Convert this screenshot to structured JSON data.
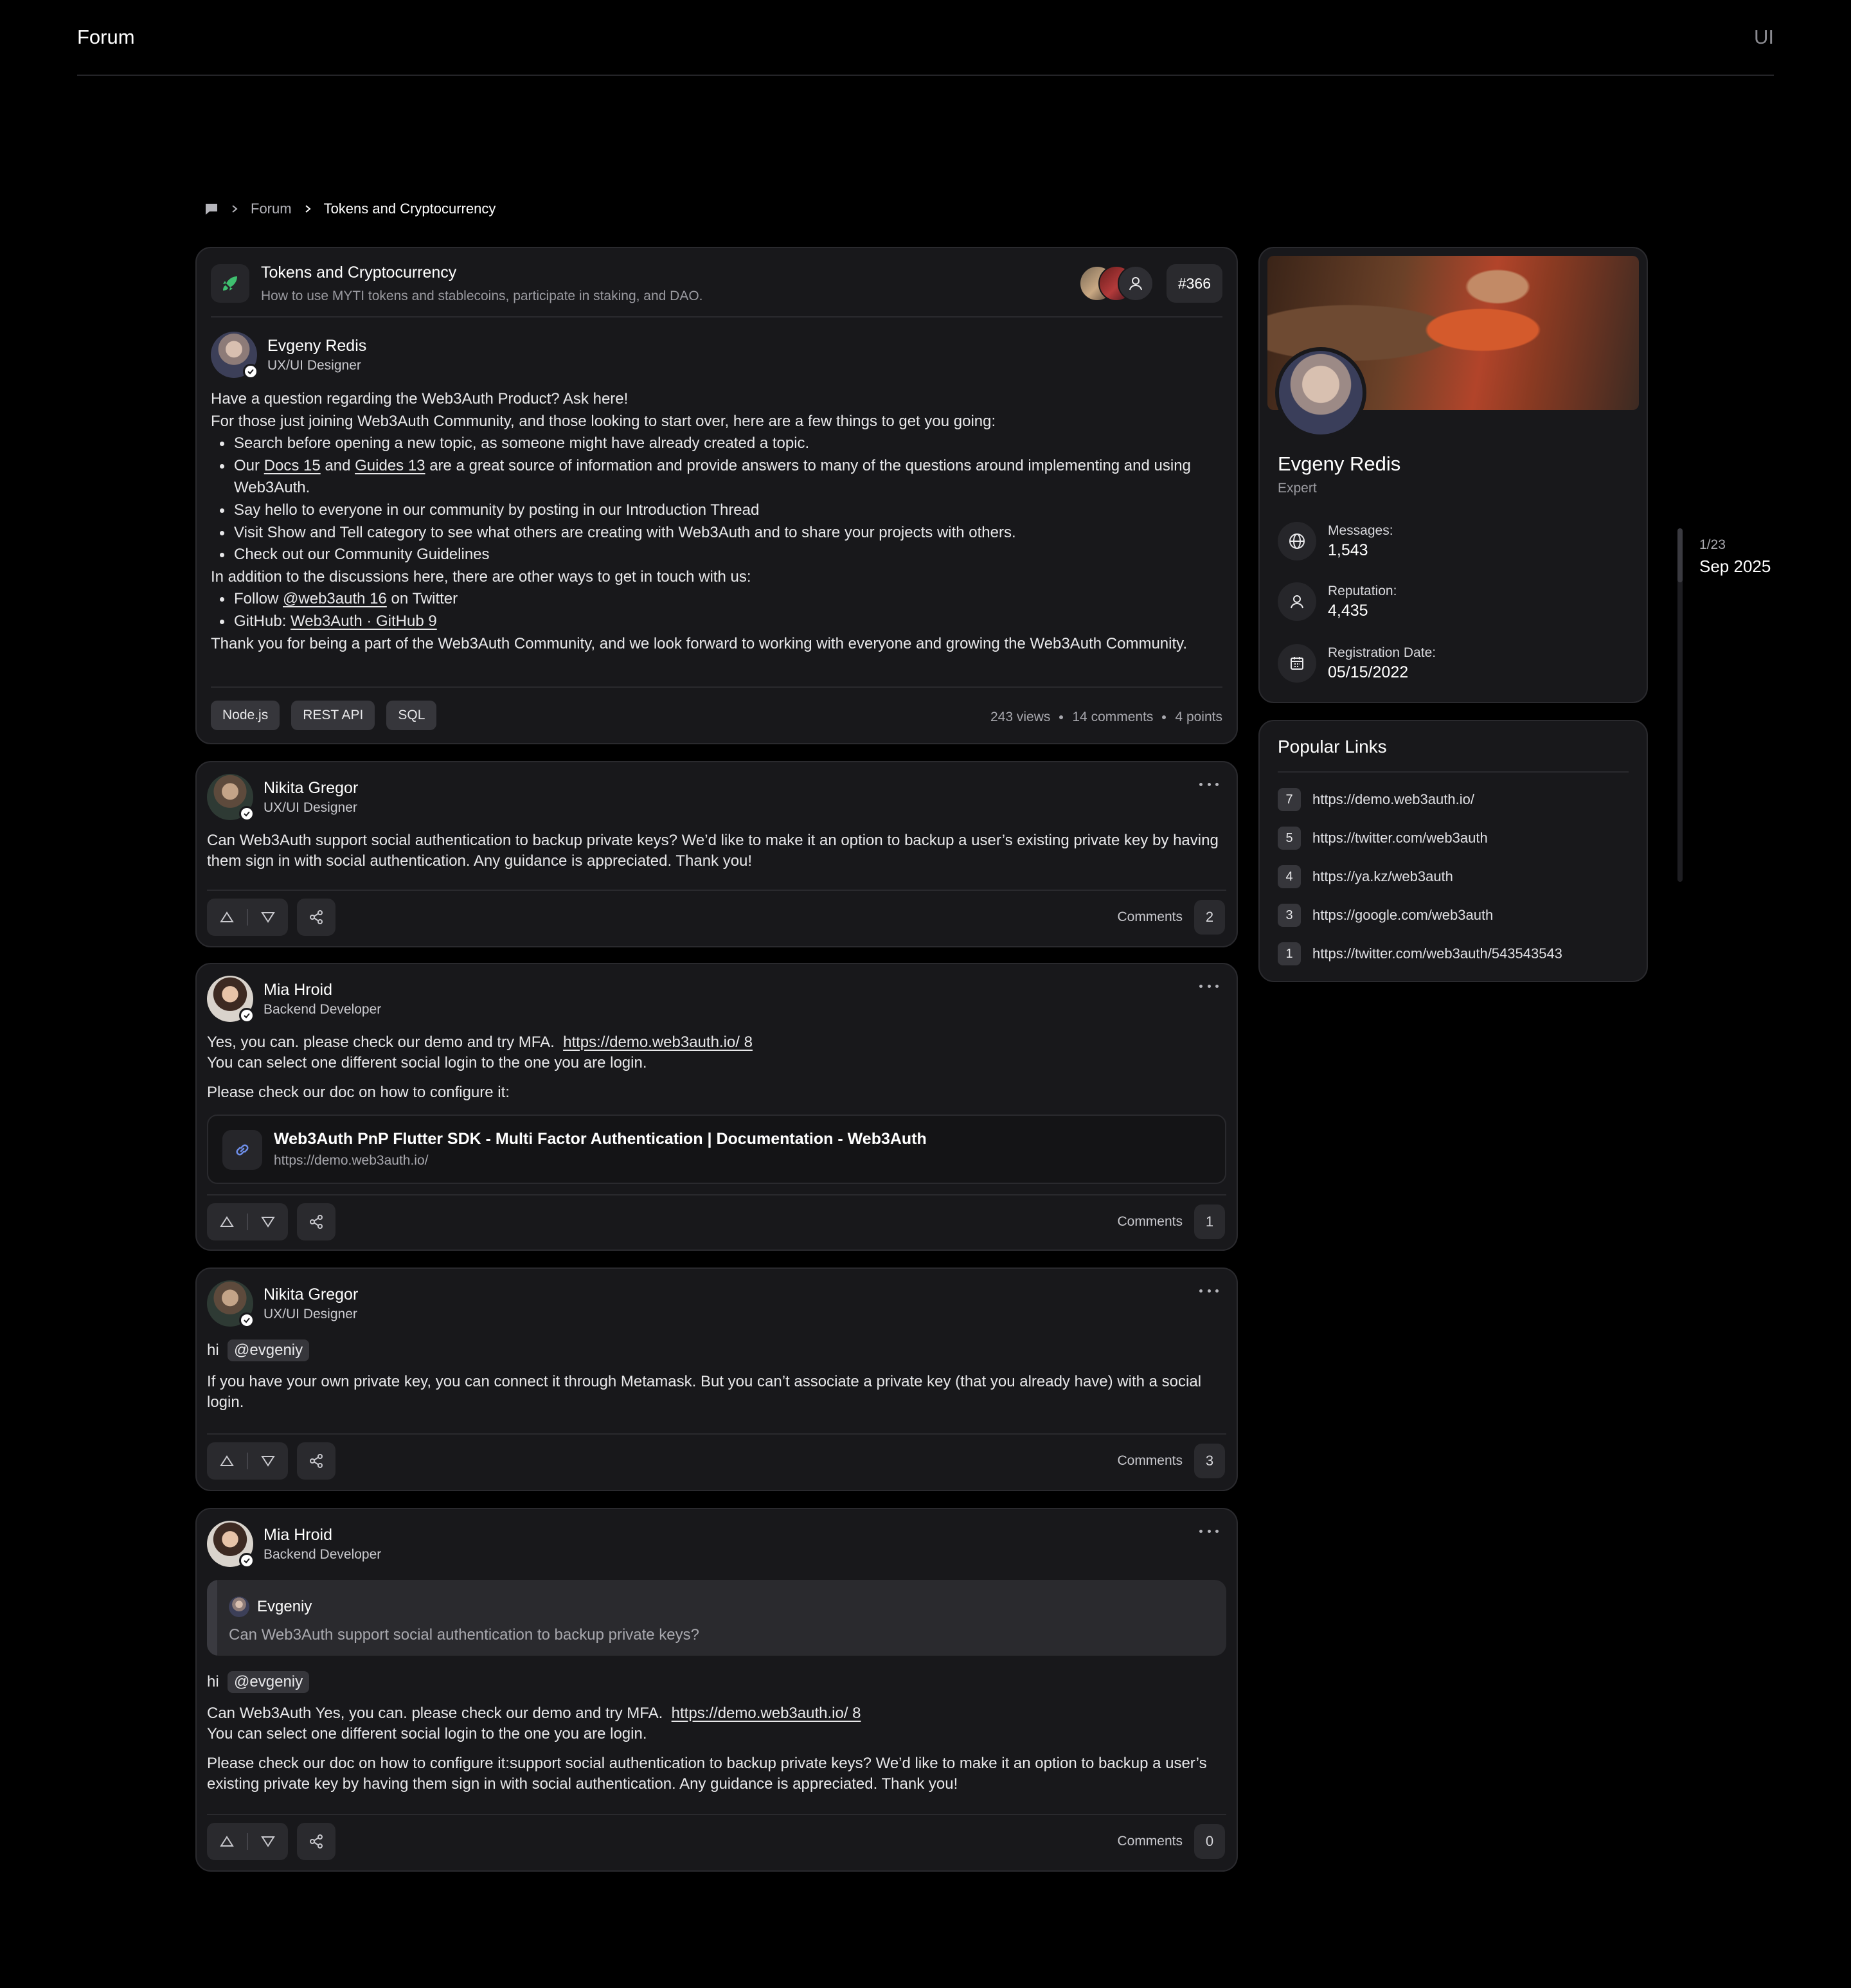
{
  "app": {
    "title": "Forum",
    "right_label": "UI"
  },
  "breadcrumb": {
    "items": [
      "Forum",
      "Tokens and Cryptocurrency"
    ]
  },
  "topic": {
    "title": "Tokens and Cryptocurrency",
    "subtitle": "How to use MYTI tokens and stablecoins, participate in staking, and DAO.",
    "badge": "#366",
    "author": {
      "name": "Evgeny Redis",
      "role": "UX/UI Designer"
    },
    "body": {
      "p1": "Have a question regarding the Web3Auth Product? Ask here!",
      "p2": "For those just joining Web3Auth Community, and those looking to start over, here are a few things to get you going:",
      "b1": "Search before opening a new topic, as someone might have already created a topic.",
      "b2_pre": "Our ",
      "b2_docs": "Docs 15",
      "b2_and": " and ",
      "b2_guides": "Guides 13",
      "b2_post": " are a great source of information and provide answers to many of the questions around implementing and using Web3Auth.",
      "b3": "Say hello to everyone in our community by posting in our Introduction Thread",
      "b4": "Visit Show and Tell category to see what others are creating with Web3Auth and to share your projects with others.",
      "b5": "Check out our Community Guidelines",
      "p3": "In addition to the discussions here, there are other ways to get in touch with us:",
      "b6_pre": "Follow ",
      "b6_link": "@web3auth 16",
      "b6_post": " on Twitter",
      "b7_pre": "GitHub: ",
      "b7_link": "Web3Auth · GitHub 9",
      "p4": "Thank you for being a part of the Web3Auth Community, and we look forward to working with everyone and growing the Web3Auth Community."
    },
    "tags": [
      "Node.js",
      "REST API",
      "SQL"
    ],
    "stats": {
      "views": "243 views",
      "comments": "14 comments",
      "points": "4 points"
    }
  },
  "posts": [
    {
      "author": {
        "name": "Nikita Gregor",
        "role": "UX/UI Designer"
      },
      "text": "Can Web3Auth support social authentication to backup private keys? We’d like to make it an option to backup a user’s existing private key by having them sign in with social authentication. Any guidance is appreciated. Thank you!",
      "comments_label": "Comments",
      "comments_count": "2"
    },
    {
      "author": {
        "name": "Mia Hroid",
        "role": "Backend Developer"
      },
      "line1": "Yes, you can. please check our demo and try MFA.",
      "line1_link": "https://demo.web3auth.io/ 8",
      "line2": "You can select one different social login to the one you are login.",
      "line3": "Please check our doc on how to configure it:",
      "link_title": "Web3Auth PnP Flutter SDK - Multi Factor Authentication | Documentation - Web3Auth",
      "link_url": "https://demo.web3auth.io/",
      "comments_label": "Comments",
      "comments_count": "1"
    },
    {
      "author": {
        "name": "Nikita Gregor",
        "role": "UX/UI Designer"
      },
      "hi": "hi",
      "mention": "@evgeniy",
      "text": "If you have your own private key, you can connect it through Metamask. But you can’t associate a private key (that you already have) with a social login.",
      "comments_label": "Comments",
      "comments_count": "3"
    },
    {
      "author": {
        "name": "Mia Hroid",
        "role": "Backend Developer"
      },
      "quote_author": "Evgeniy",
      "quote_text": "Can Web3Auth support social authentication to backup private keys?",
      "hi": "hi",
      "mention": "@evgeniy",
      "line1": "Can Web3Auth Yes, you can. please check our demo and try MFA.",
      "line1_link": "https://demo.web3auth.io/ 8",
      "line2": "You can select one different social login to the one you are login.",
      "line3": "Please check our doc on how to configure it:support social authentication to backup private keys? We’d like to make it an option to backup a user’s existing private key by having them sign in with social authentication. Any guidance is appreciated. Thank you!",
      "comments_label": "Comments",
      "comments_count": "0"
    }
  ],
  "profile": {
    "name": "Evgeny Redis",
    "role": "Expert",
    "messages_label": "Messages:",
    "messages": "1,543",
    "reputation_label": "Reputation:",
    "reputation": "4,435",
    "registration_label": "Registration Date:",
    "registration": "05/15/2022"
  },
  "popular_links": {
    "title": "Popular Links",
    "items": [
      {
        "count": "7",
        "url": "https://demo.web3auth.io/"
      },
      {
        "count": "5",
        "url": "https://twitter.com/web3auth"
      },
      {
        "count": "4",
        "url": "https://ya.kz/web3auth"
      },
      {
        "count": "3",
        "url": "https://google.com/web3auth"
      },
      {
        "count": "1",
        "url": "https://twitter.com/web3auth/543543543"
      }
    ]
  },
  "timeline": {
    "page": "1/23",
    "date": "Sep 2025"
  },
  "icons": {
    "accent_green": "#3fbf6f",
    "link_blue": "#6e8ee8"
  }
}
